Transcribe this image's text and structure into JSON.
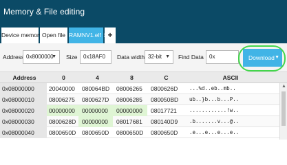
{
  "window": {
    "title": "Memory & File editing"
  },
  "tabs": [
    {
      "label": "Device memory",
      "active": false
    },
    {
      "label": "Open file",
      "active": false
    },
    {
      "label": "RAMNV1.elf",
      "active": true,
      "close": "✕"
    },
    {
      "label": "+",
      "active": false
    }
  ],
  "toolbar": {
    "address_label": "Address",
    "address_value": "0x8000000",
    "size_label": "Size",
    "size_value": "0x18AF0",
    "data_width_label": "Data width",
    "data_width_value": "32-bit",
    "find_label": "Find Data",
    "find_value": "0x",
    "download_label": "Download"
  },
  "grid": {
    "headers": [
      "Address",
      "0",
      "4",
      "8",
      "C",
      "ASCII"
    ],
    "rows": [
      {
        "address": "0x08000000",
        "c0": "20040000",
        "c4": "080064BD",
        "c8": "08006265",
        "cC": "0800626D",
        "ascii": "...%d..eb..mb..",
        "mod": [
          false,
          false,
          false,
          false
        ]
      },
      {
        "address": "0x08000010",
        "c0": "08006275",
        "c4": "0800627D",
        "c8": "08006285",
        "cC": "080050BD",
        "ascii": "ub..}b...b...P..",
        "mod": [
          false,
          false,
          false,
          false
        ]
      },
      {
        "address": "0x08000020",
        "c0": "00000000",
        "c4": "00000000",
        "c8": "00000000",
        "cC": "08017721",
        "ascii": "............!w..",
        "mod": [
          true,
          true,
          true,
          false
        ]
      },
      {
        "address": "0x08000030",
        "c0": "0800628D",
        "c4": "00000000",
        "c8": "08017681",
        "cC": "080140D9",
        "ascii": ".b.......v...@..",
        "mod": [
          false,
          true,
          false,
          false
        ]
      },
      {
        "address": "0x08000040",
        "c0": "0800650D",
        "c4": "0800650D",
        "c8": "0800650D",
        "cC": "0800650D",
        "ascii": ".e...e...e...e..",
        "mod": [
          false,
          false,
          false,
          false
        ]
      }
    ]
  },
  "colors": {
    "titlebar": "#0b4a66",
    "accent": "#41b4e6",
    "modified_cell": "#dff5d4",
    "highlight_ring": "#43d64b"
  }
}
